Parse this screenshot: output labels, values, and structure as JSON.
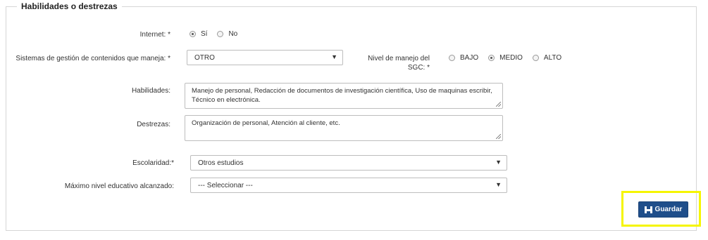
{
  "section": {
    "title": "Habilidades o destrezas"
  },
  "internet": {
    "label": "Internet: *",
    "options": [
      "Sí",
      "No"
    ],
    "selected": "Sí"
  },
  "cms": {
    "label": "Sistemas de gestión de contenidos que maneja: *",
    "value": "OTRO"
  },
  "sgc_level": {
    "label_line1": "Nivel de manejo del",
    "label_line2": "SGC: *",
    "options": [
      "BAJO",
      "MEDIO",
      "ALTO"
    ],
    "selected": "MEDIO"
  },
  "habilidades": {
    "label": "Habilidades:",
    "value": "Manejo de personal, Redacción de documentos de investigación científica, Uso de maquinas escribir, Técnico en electrónica."
  },
  "destrezas": {
    "label": "Destrezas:",
    "value": "Organización de personal, Atención al cliente, etc."
  },
  "escolaridad": {
    "label": "Escolaridad:*",
    "value": "Otros estudios"
  },
  "nivel_educativo": {
    "label": "Máximo nivel educativo alcanzado:",
    "value": "--- Seleccionar ---"
  },
  "save_button": {
    "label": "Guardar",
    "icon": "save-icon",
    "color": "#1f4e8a"
  },
  "highlight_color": "#f5f500"
}
